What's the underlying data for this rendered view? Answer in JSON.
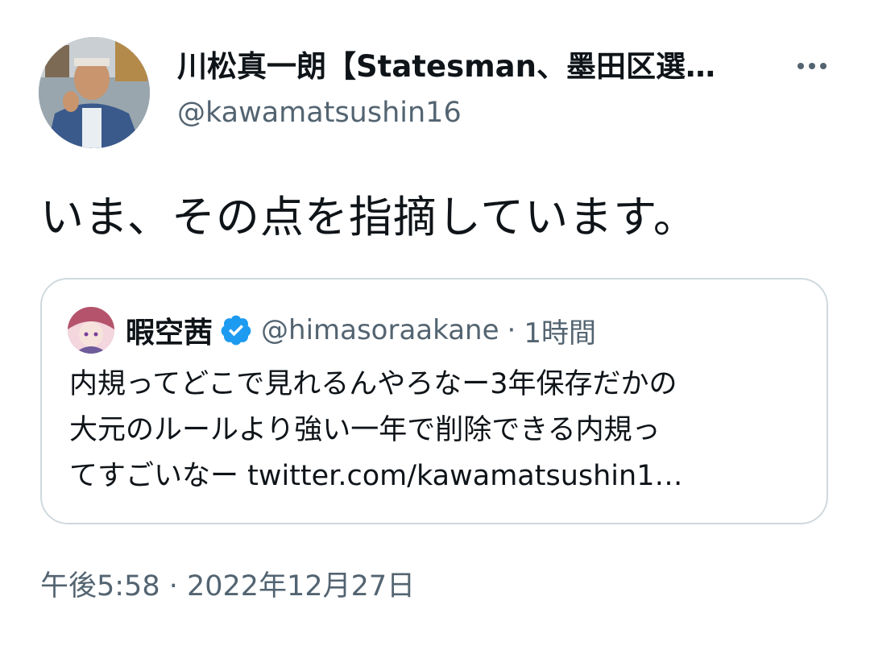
{
  "tweet": {
    "author": {
      "display_name": "川松真一朗【Statesman、墨田区選…",
      "handle": "@kawamatsushin16"
    },
    "more_icon": "more-horizontal-icon",
    "text": "いま、その点を指摘しています。",
    "quoted": {
      "display_name": "暇空茜",
      "verified_icon": "verified-badge-icon",
      "handle": "@himasoraakane",
      "separator": "·",
      "time": "1時間",
      "lines": [
        "内規ってどこで見れるんやろなー3年保存だかの",
        "大元のルールより強い一年で削除できる内規っ",
        "てすごいなー twitter.com/kawamatsushin1…"
      ]
    },
    "timestamp": "午後5:58 · 2022年12月27日"
  },
  "colors": {
    "text_primary": "#0f1419",
    "text_secondary": "#536471",
    "border": "#cfd9de",
    "verified": "#1d9bf0"
  }
}
